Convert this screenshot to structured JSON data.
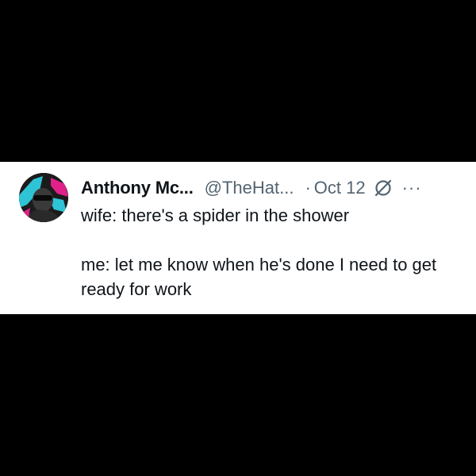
{
  "tweet": {
    "display_name": "Anthony Mc...",
    "handle": "@TheHat...",
    "separator": "·",
    "date": "Oct 12",
    "more_label": "···",
    "lines": [
      "wife: there's a spider in the shower",
      "me: let me know when he's done I need to get ready for work"
    ]
  },
  "icons": {
    "avatar": "profile-avatar",
    "grok": "grok-icon",
    "more": "more-options-icon"
  },
  "colors": {
    "background": "#000000",
    "card": "#ffffff",
    "primary_text": "#0f1419",
    "secondary_text": "#536471",
    "avatar_accent": "#2ec4d6"
  }
}
